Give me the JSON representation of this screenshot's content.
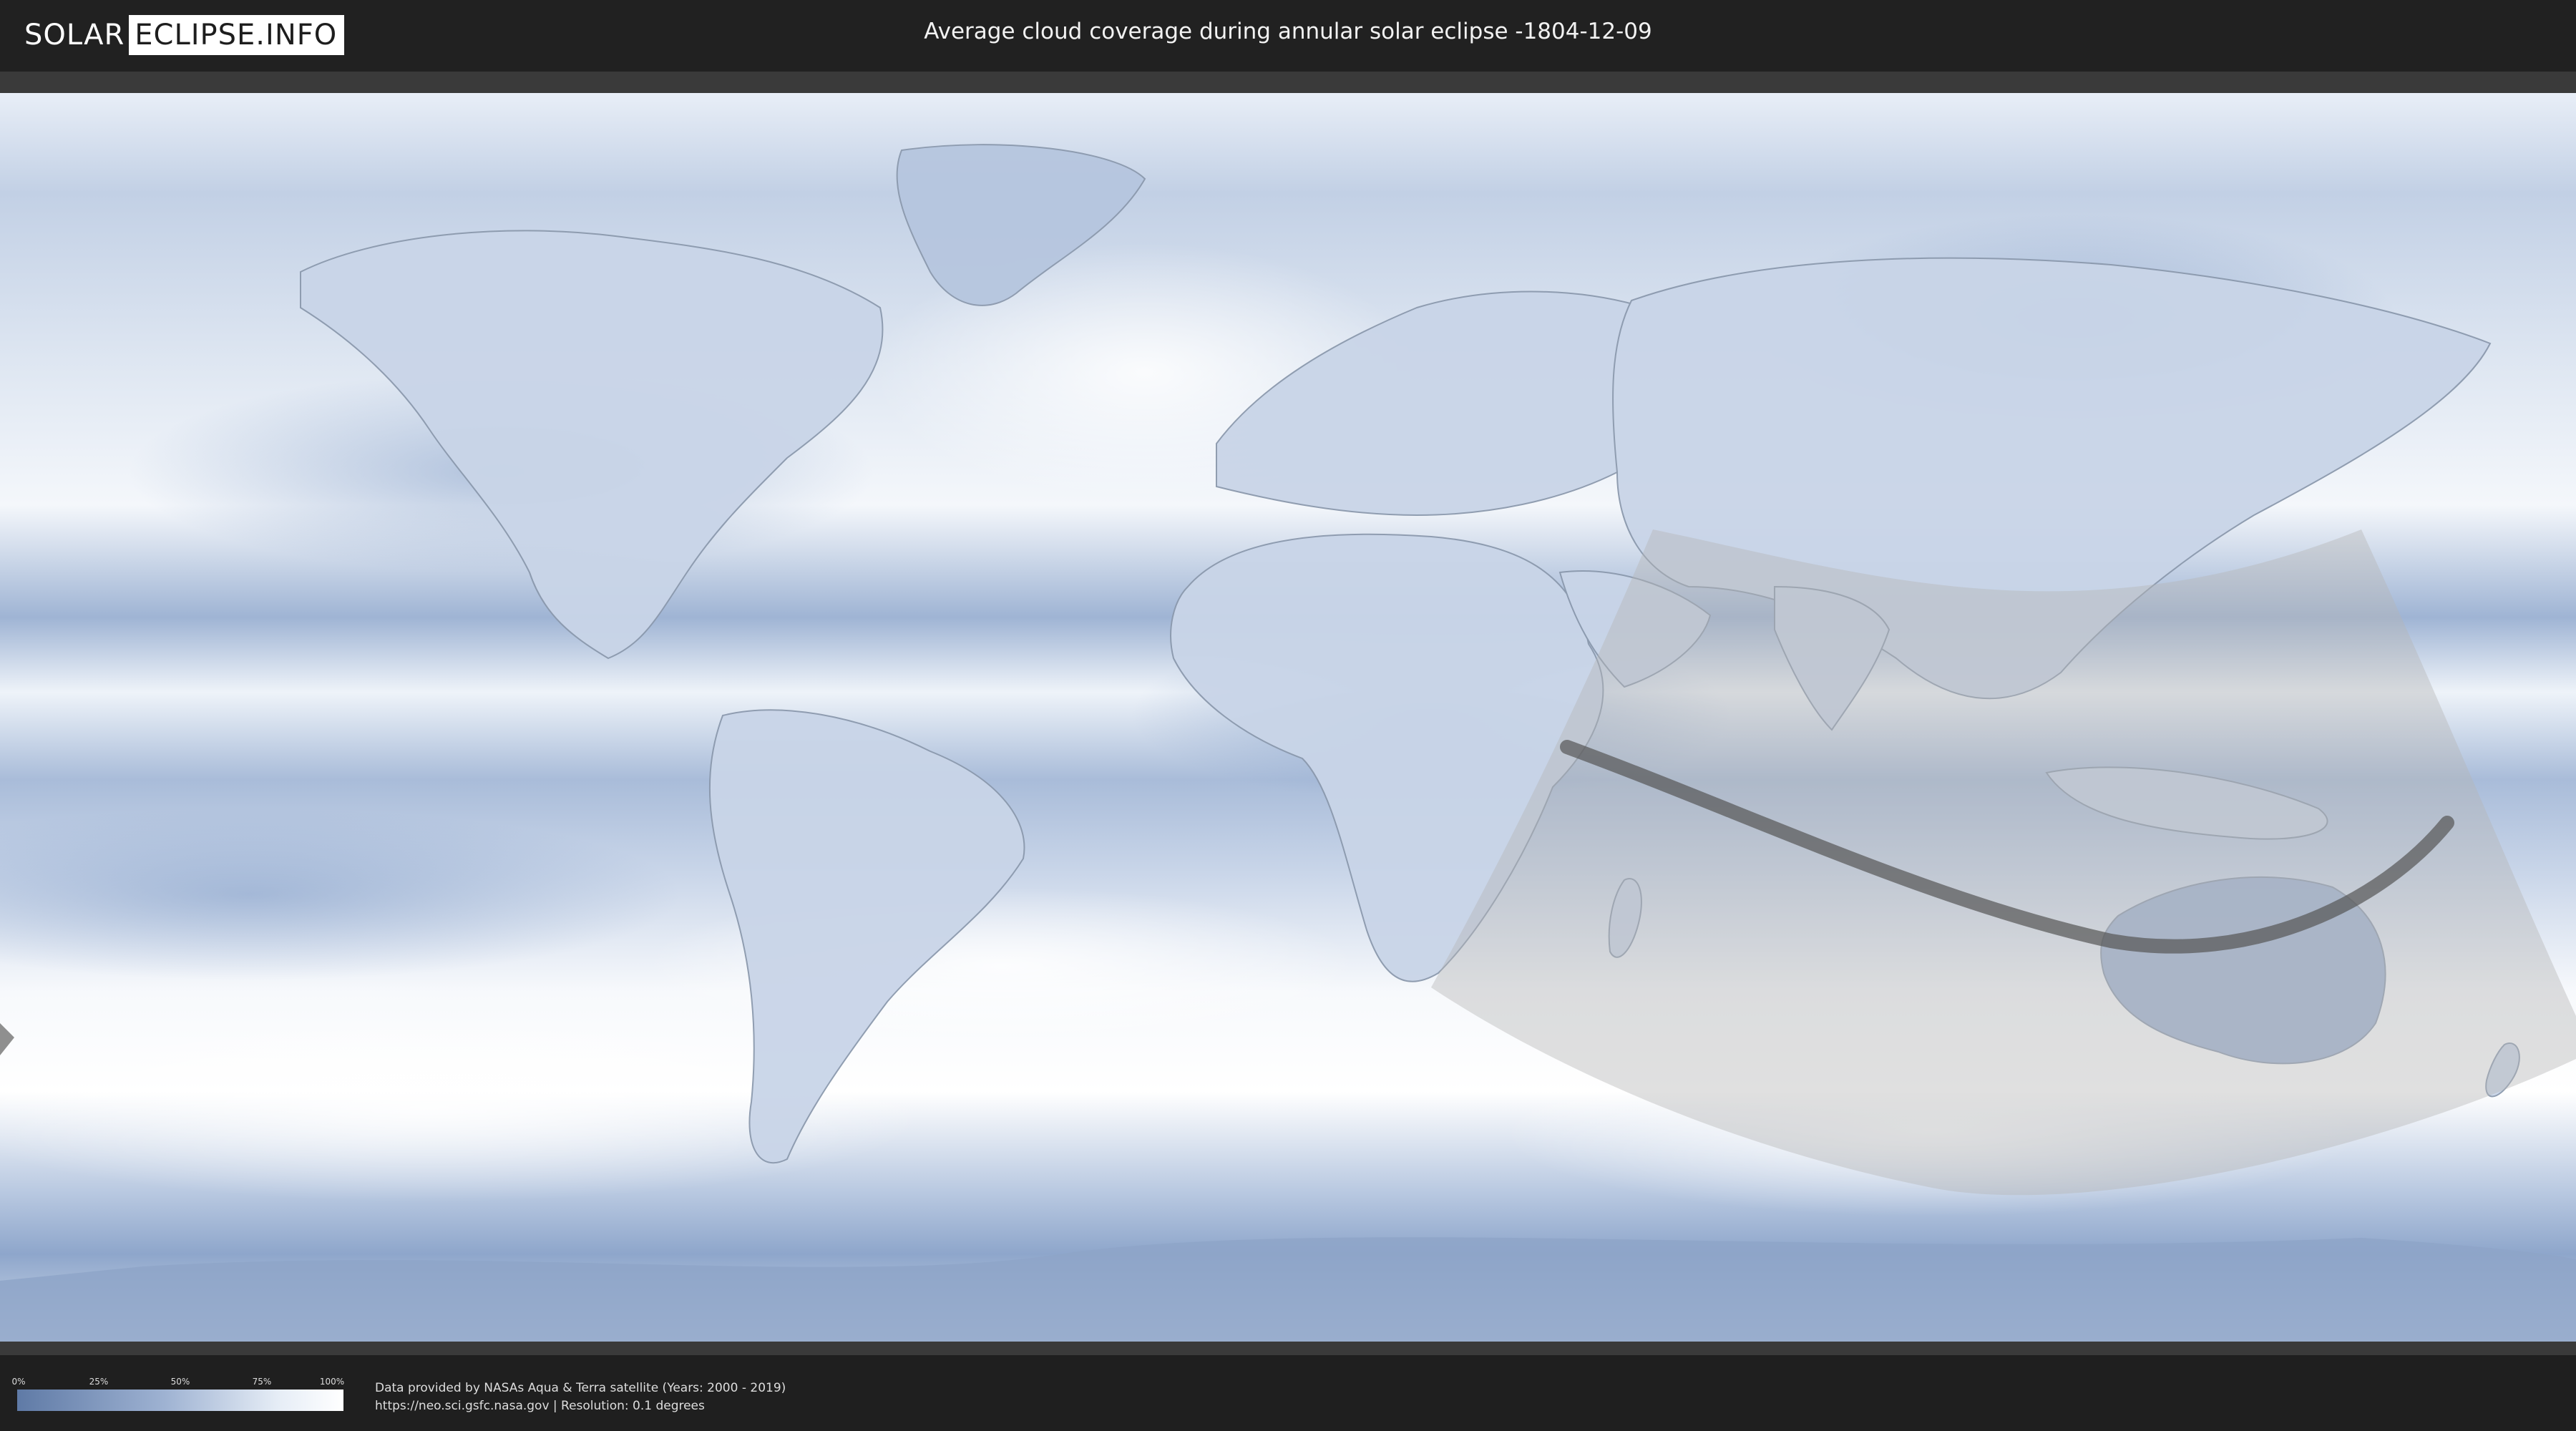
{
  "header": {
    "logo_left": "SOLAR",
    "logo_right": "ECLIPSE.INFO",
    "title": "Average cloud coverage during annular solar eclipse -1804-12-09"
  },
  "legend": {
    "ticks": [
      "0%",
      "25%",
      "50%",
      "75%",
      "100%"
    ],
    "colors": {
      "low": "#5f7aa6",
      "mid": "#9eb2d2",
      "high": "#ffffff"
    }
  },
  "credits": {
    "line1": "Data provided by NASAs Aqua & Terra satellite (Years: 2000 - 2019)",
    "line2": "https://neo.sci.gsfc.nasa.gov | Resolution: 0.1 degrees"
  },
  "map": {
    "projection": "equirectangular",
    "layers": [
      "cloud-coverage",
      "country-borders",
      "eclipse-visibility-zone",
      "annularity-path"
    ],
    "colors": {
      "ocean_clear": "#6f8fbe",
      "cloud": "#ffffff",
      "eclipse_zone": "#b9b9b9",
      "central_path": "#555555"
    }
  }
}
